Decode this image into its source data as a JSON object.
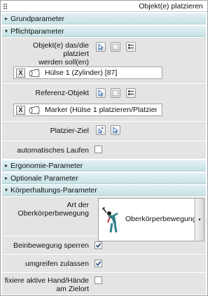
{
  "window": {
    "title": "Objekt(e) platzieren"
  },
  "sections": {
    "grundparameter": {
      "label": "Grundparameter",
      "expanded": false,
      "arrow": "▸"
    },
    "pflichtparameter": {
      "label": "Pflichtparameter",
      "expanded": true,
      "arrow": "▾"
    },
    "ergonomie": {
      "label": "Ergonomie-Parameter",
      "expanded": false,
      "arrow": "▸"
    },
    "optionale": {
      "label": "Optionale Parameter",
      "expanded": false,
      "arrow": "▸"
    },
    "koerperhaltung": {
      "label": "Körperhaltungs-Parameter",
      "expanded": true,
      "arrow": "▾"
    }
  },
  "pflicht": {
    "objects_label_line1": "Objekt(e) das/die platziert",
    "objects_label_line2": "werden soll(en)",
    "objects_value": "Hülse 1 (Zylinder) [87]",
    "referenz_label": "Referenz-Objekt",
    "referenz_value": "Marker (Hülse 1 platzieren/Platzier-...",
    "ziel_label": "Platzier-Ziel",
    "auto_label": "automatisches Laufen",
    "auto_checked": false,
    "remove_glyph": "X"
  },
  "koerper": {
    "art_label_line1": "Art der",
    "art_label_line2": "Oberkörperbewegung",
    "art_value": "Oberkörperbewegung",
    "dropdown_arrow": "▾",
    "beinbewegung_label": "Beinbewegung sperren",
    "beinbewegung_checked": true,
    "umgreifen_label": "umgreifen zulassen",
    "umgreifen_checked": true,
    "fixiere_label_line1": "fixiere aktive Hand/Hände",
    "fixiere_label_line2": "am Zielort",
    "fixiere_checked": false
  },
  "icons": {
    "pick": "cursor-arrow-icon",
    "clear": "blank-box-icon",
    "list": "list-icon",
    "target": "target-pick-icon",
    "figure": "body-posture-icon"
  }
}
